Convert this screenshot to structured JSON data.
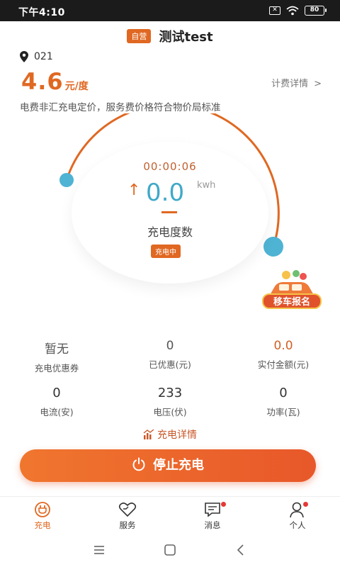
{
  "status_bar": {
    "time": "下午4:10",
    "battery": "80",
    "x_icon": "✕"
  },
  "header": {
    "tag": "自营",
    "title": "测试test"
  },
  "location": {
    "code": "021"
  },
  "price": {
    "value": "4.6",
    "unit": "元/度",
    "detail_link": "计费详情",
    "chevron": ">"
  },
  "notice": "电费非汇充电定价，服务费价格符合物价局标准",
  "meter": {
    "timer": "00:00:06",
    "value": "0.0",
    "unit": "kwh",
    "label": "充电度数",
    "status_badge": "充电中",
    "arrow": "↑"
  },
  "promo": {
    "label": "移车报名"
  },
  "stats_row1": [
    {
      "value": "暂无",
      "label": "充电优惠券"
    },
    {
      "value": "0",
      "label": "已优惠(元)"
    },
    {
      "value": "0.0",
      "label": "实付金额(元)"
    }
  ],
  "stats_row2": [
    {
      "value": "0",
      "label": "电流(安)"
    },
    {
      "value": "233",
      "label": "电压(伏)"
    },
    {
      "value": "0",
      "label": "功率(瓦)"
    }
  ],
  "detail_link": "充电详情",
  "stop_button": "停止充电",
  "bottom_nav": [
    {
      "label": "充电",
      "icon": "charge-icon",
      "active": true
    },
    {
      "label": "服务",
      "icon": "service-icon",
      "active": false
    },
    {
      "label": "消息",
      "icon": "message-icon",
      "active": false
    },
    {
      "label": "个人",
      "icon": "user-icon",
      "active": false
    }
  ],
  "colors": {
    "accent": "#e06822",
    "cyan": "#4fb3d4",
    "stop_button": "#ee6a2c"
  }
}
